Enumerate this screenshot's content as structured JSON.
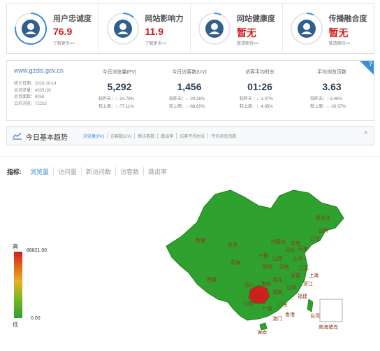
{
  "kpis": [
    {
      "title": "用户忠诚度",
      "value": "76.9",
      "link": "了解更多>>",
      "icon": "user-loyalty-icon",
      "percent": 76.9
    },
    {
      "title": "网站影响力",
      "value": "11.9",
      "link": "了解更多>>",
      "icon": "influence-icon",
      "percent": 11.9
    },
    {
      "title": "网站健康度",
      "value": "暂无",
      "link": "敬请期待>>",
      "icon": "health-icon",
      "percent": 0
    },
    {
      "title": "传播融合度",
      "value": "暂无",
      "link": "敬请期待>>",
      "icon": "spread-icon",
      "percent": 0
    }
  ],
  "site": {
    "domain": "www.gzdis.gov.cn",
    "meta": [
      "统计日期：2016-10-14",
      "总浏览量：4335192",
      "总页面数：8058",
      "日均浏览：72253"
    ]
  },
  "metrics": [
    {
      "label": "今日浏览量(PV)",
      "value": "5,292",
      "yesterday_label": "较昨天：",
      "yesterday": "-24.79%",
      "yesterday_dir": "down",
      "lastweek_label": "较上周：",
      "lastweek": "-77.11%",
      "lastweek_dir": "down"
    },
    {
      "label": "今日访客数(UV)",
      "value": "1,456",
      "yesterday_label": "较昨天：",
      "yesterday": "-29.36%",
      "yesterday_dir": "down",
      "lastweek_label": "较上周：",
      "lastweek": "-68.65%",
      "lastweek_dir": "down"
    },
    {
      "label": "访客平均时长",
      "value": "01:26",
      "yesterday_label": "较昨天：",
      "yesterday": "-1.07%",
      "yesterday_dir": "down",
      "lastweek_label": "较上周：",
      "lastweek": "-4.85%",
      "lastweek_dir": "down"
    },
    {
      "label": "平均浏览页数",
      "value": "3.63",
      "yesterday_label": "较昨天：",
      "yesterday": "6.46%",
      "yesterday_dir": "up",
      "lastweek_label": "较上周：",
      "lastweek": "-26.97%",
      "lastweek_dir": "down"
    }
  ],
  "help": "?",
  "trend": {
    "title": "今日基本趋势",
    "tabs": [
      "浏览量(PV)",
      "访客数(UV)",
      "新访客数",
      "跳出率",
      "访客平均时长",
      "平均浏览页数"
    ],
    "collapse": "^"
  },
  "indicator": {
    "label": "指标:",
    "tabs": [
      "浏览量",
      "访问量",
      "新访问数",
      "访客数",
      "跳出率"
    ],
    "active": 0
  },
  "legend": {
    "high": "高",
    "low": "低",
    "max": "86821.00",
    "min": "0.00"
  },
  "map": {
    "colors": {
      "base": "#2ea12e",
      "hot": "#d21e1e",
      "border": "#1d7d1d"
    },
    "provinces": [
      {
        "name": "黑龙江",
        "hot": false
      },
      {
        "name": "吉林",
        "hot": false
      },
      {
        "name": "辽宁",
        "hot": false
      },
      {
        "name": "内蒙古",
        "hot": false
      },
      {
        "name": "新疆",
        "hot": false
      },
      {
        "name": "甘肃",
        "hot": false
      },
      {
        "name": "西藏",
        "hot": false
      },
      {
        "name": "四川",
        "hot": false
      },
      {
        "name": "贵州",
        "hot": true
      },
      {
        "name": "云南",
        "hot": false
      },
      {
        "name": "广西",
        "hot": false
      },
      {
        "name": "广东",
        "hot": false
      },
      {
        "name": "湖南",
        "hot": false
      },
      {
        "name": "湖北",
        "hot": false
      },
      {
        "name": "江西",
        "hot": false
      },
      {
        "name": "福建",
        "hot": false
      },
      {
        "name": "浙江",
        "hot": false
      },
      {
        "name": "上海",
        "hot": false
      },
      {
        "name": "江苏",
        "hot": false
      },
      {
        "name": "安徽",
        "hot": false
      },
      {
        "name": "河南",
        "hot": false
      },
      {
        "name": "山东",
        "hot": false
      },
      {
        "name": "河北",
        "hot": false
      },
      {
        "name": "北京",
        "hot": false
      },
      {
        "name": "天津",
        "hot": false
      },
      {
        "name": "山西",
        "hot": false
      },
      {
        "name": "陕西",
        "hot": false
      },
      {
        "name": "宁夏",
        "hot": false
      },
      {
        "name": "青海",
        "hot": false
      },
      {
        "name": "重庆",
        "hot": false
      },
      {
        "name": "海南",
        "hot": false
      },
      {
        "name": "台湾",
        "hot": false
      },
      {
        "name": "香港",
        "hot": false
      },
      {
        "name": "澳门",
        "hot": false
      },
      {
        "name": "南海诸岛",
        "hot": false
      }
    ]
  }
}
